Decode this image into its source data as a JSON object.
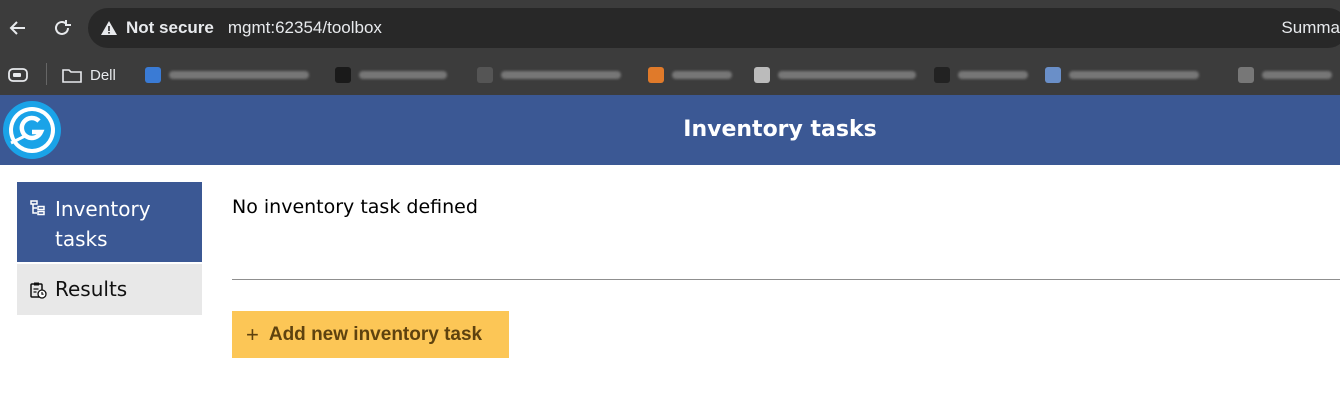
{
  "browser": {
    "security_label": "Not secure",
    "url": "mgmt:62354/toolbox",
    "right_text": "Summa",
    "bookmarks": [
      {
        "label": "Dell"
      }
    ]
  },
  "header": {
    "title": "Inventory tasks"
  },
  "sidebar": {
    "items": [
      {
        "label": "Inventory tasks",
        "active": true
      },
      {
        "label": "Results",
        "active": false
      }
    ]
  },
  "main": {
    "empty_message": "No inventory task defined",
    "add_button_label": "Add new inventory task",
    "add_button_icon": "+"
  },
  "colors": {
    "header_bg": "#3b5894",
    "button_bg": "#fcc656",
    "button_text": "#5e420f"
  }
}
